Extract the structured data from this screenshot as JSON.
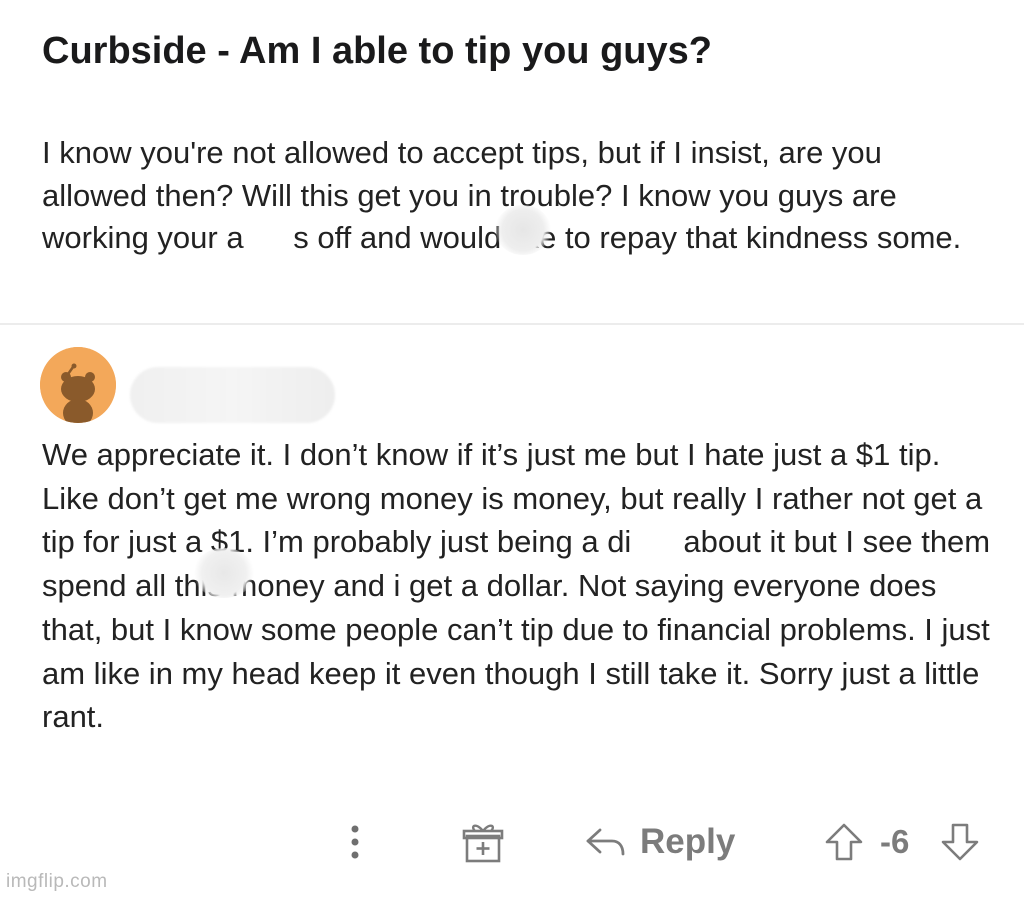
{
  "post": {
    "title": "Curbside - Am I able to tip you guys?",
    "body": "I know you're not allowed to accept tips, but if I insist, are you allowed then?  Will this get you in trouble?  I know you guys are working your a        s off and would like to repay that kindness some."
  },
  "comment": {
    "body": "We appreciate it. I don’t know if it’s just me but I hate just a $1 tip. Like don’t get me wrong money is money, but really I rather not get a tip for just a $1. I’m probably just being a di        about it but I see them spend all this money and i get a dollar. Not saying everyone does that, but I know some people can’t tip due to financial problems. I just am like in my head keep it even though I still take it. Sorry just a little rant."
  },
  "actions": {
    "more_icon": "more-vertical-icon",
    "gift_icon": "gift-icon",
    "reply_icon": "reply-arrow-icon",
    "reply_label": "Reply",
    "upvote_icon": "upvote-arrow-icon",
    "vote_count": "-6",
    "downvote_icon": "downvote-arrow-icon"
  },
  "watermark": "imgflip.com",
  "colors": {
    "avatar_background": "#f3a85a",
    "avatar_figure": "#8a5a2b",
    "action_gray": "#7c7c7c",
    "text": "#222222"
  }
}
